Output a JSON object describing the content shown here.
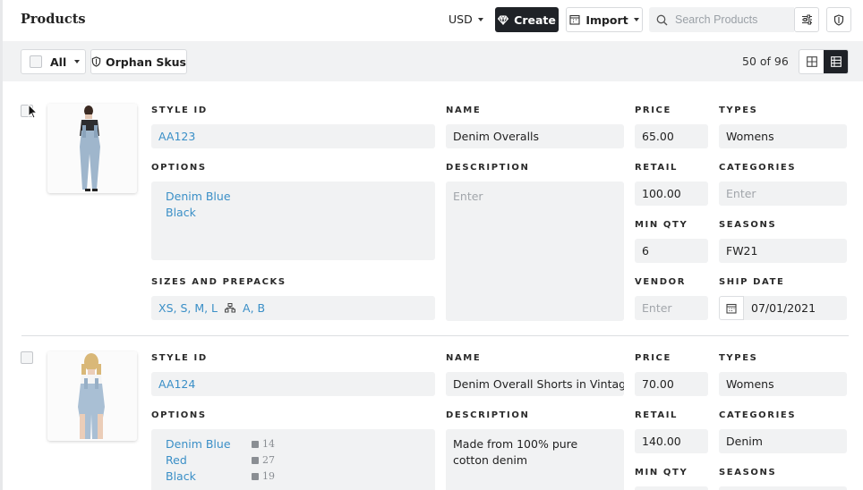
{
  "header": {
    "title": "Products",
    "currency": "USD",
    "create_label": "Create",
    "import_label": "Import",
    "search_placeholder": "Search Products"
  },
  "toolbar": {
    "select_label": "All",
    "orphan_label": "Orphan Skus",
    "count": "50 of 96"
  },
  "labels": {
    "style_id": "STYLE ID",
    "name": "NAME",
    "price": "PRICE",
    "types": "TYPES",
    "options": "OPTIONS",
    "description": "DESCRIPTION",
    "retail": "RETAIL",
    "categories": "CATEGORIES",
    "min_qty": "MIN QTY",
    "seasons": "SEASONS",
    "sizes": "SIZES AND PREPACKS",
    "vendor": "VENDOR",
    "ship_date": "SHIP DATE"
  },
  "products": [
    {
      "style_id": "AA123",
      "name": "Denim Overalls",
      "price": "65.00",
      "types": "Womens",
      "options": [
        {
          "label": "Denim Blue"
        },
        {
          "label": "Black"
        }
      ],
      "description": "",
      "description_placeholder": "Enter",
      "retail": "100.00",
      "categories": "",
      "categories_placeholder": "Enter",
      "min_qty": "6",
      "seasons": "FW21",
      "sizes": "XS, S, M, L",
      "prepacks": "A, B",
      "vendor": "",
      "vendor_placeholder": "Enter",
      "ship_date": "07/01/2021"
    },
    {
      "style_id": "AA124",
      "name": "Denim Overall Shorts in Vintage Wash",
      "price": "70.00",
      "types": "Womens",
      "options": [
        {
          "label": "Denim Blue",
          "qty": "14"
        },
        {
          "label": "Red",
          "qty": "27"
        },
        {
          "label": "Black",
          "qty": "19"
        }
      ],
      "description": "Made from 100% pure cotton denim",
      "retail": "140.00",
      "categories": "Denim"
    }
  ],
  "colors": {
    "accent_dark": "#1f2227",
    "link": "#3a8fc7",
    "field_bg": "#f1f2f3"
  }
}
